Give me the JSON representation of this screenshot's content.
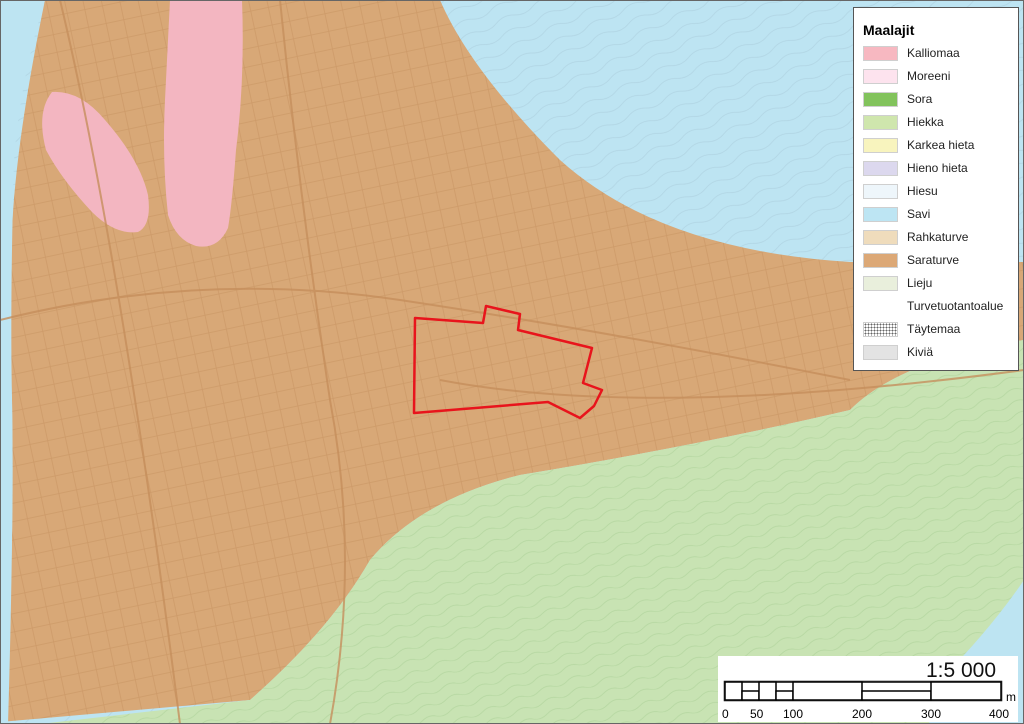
{
  "legend": {
    "title": "Maalajit",
    "items": [
      {
        "label": "Kalliomaa",
        "color": "#f7b8c1",
        "pattern": "solid"
      },
      {
        "label": "Moreeni",
        "color": "#fde3ee",
        "pattern": "solid"
      },
      {
        "label": "Sora",
        "color": "#82c35c",
        "pattern": "solid"
      },
      {
        "label": "Hiekka",
        "color": "#cfe6ad",
        "pattern": "solid"
      },
      {
        "label": "Karkea hieta",
        "color": "#f8f4be",
        "pattern": "solid"
      },
      {
        "label": "Hieno hieta",
        "color": "#dcd8ee",
        "pattern": "solid"
      },
      {
        "label": "Hiesu",
        "color": "#eef6fb",
        "pattern": "solid"
      },
      {
        "label": "Savi",
        "color": "#bde5f3",
        "pattern": "solid"
      },
      {
        "label": "Rahkaturve",
        "color": "#efdcbc",
        "pattern": "solid"
      },
      {
        "label": "Saraturve",
        "color": "#dca876",
        "pattern": "solid"
      },
      {
        "label": "Lieju",
        "color": "#e9efdc",
        "pattern": "solid"
      },
      {
        "label": "Turvetuotantoalue",
        "color": "#ffffff",
        "pattern": "none"
      },
      {
        "label": "Täytemaa",
        "color": "#ffffff",
        "pattern": "dots"
      },
      {
        "label": "Kiviä",
        "color": "#e3e3e3",
        "pattern": "solid"
      }
    ]
  },
  "scalebar": {
    "ratio": "1:5 000",
    "unit": "m",
    "ticks": [
      "0",
      "50",
      "100",
      "200",
      "300",
      "400"
    ]
  },
  "map": {
    "colors": {
      "saraturve": "#d8a877",
      "savi": "#bde4f2",
      "hiekka": "#c8e3b3",
      "kalliomaa": "#f3b6c1",
      "boundary": "#e8141c",
      "streets": "#c9935f"
    }
  }
}
